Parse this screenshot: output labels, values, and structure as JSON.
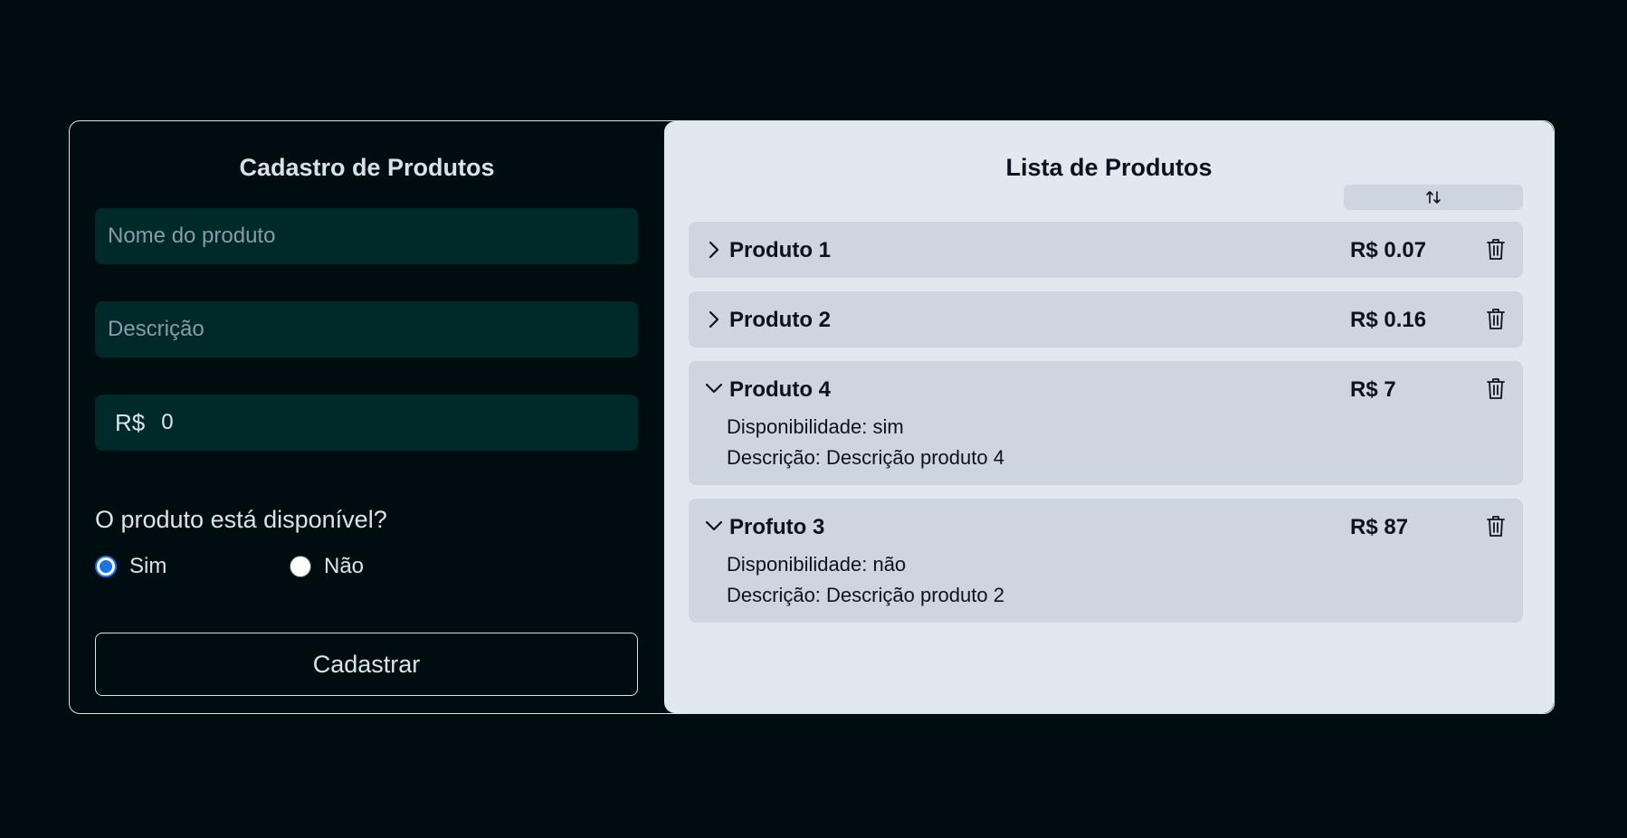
{
  "form": {
    "title": "Cadastro de Produtos",
    "name_placeholder": "Nome do produto",
    "name_value": "",
    "description_placeholder": "Descrição",
    "description_value": "",
    "price_prefix": "R$",
    "price_value": "0",
    "availability_question": "O produto está disponível?",
    "option_yes": "Sim",
    "option_no": "Não",
    "selected_option": "Sim",
    "submit_label": "Cadastrar"
  },
  "list": {
    "title": "Lista de Produtos",
    "sort_icon": "sort-arrows-icon",
    "availability_label": "Disponibilidade:",
    "description_label": "Descrição:",
    "items": [
      {
        "name": "Produto 1",
        "price": "R$ 0.07",
        "expanded": false
      },
      {
        "name": "Produto 2",
        "price": "R$ 0.16",
        "expanded": false
      },
      {
        "name": "Produto 4",
        "price": "R$ 7",
        "expanded": true,
        "availability": "sim",
        "description": "Descrição produto 4"
      },
      {
        "name": "Profuto 3",
        "price": "R$ 87",
        "expanded": true,
        "availability": "não",
        "description": "Descrição produto 2"
      }
    ]
  },
  "colors": {
    "page_bg": "#000d10",
    "input_bg": "#002a2a",
    "list_bg": "#e2e8f0",
    "item_bg": "#cdd6e0",
    "radio_accent": "#1a73e8"
  }
}
